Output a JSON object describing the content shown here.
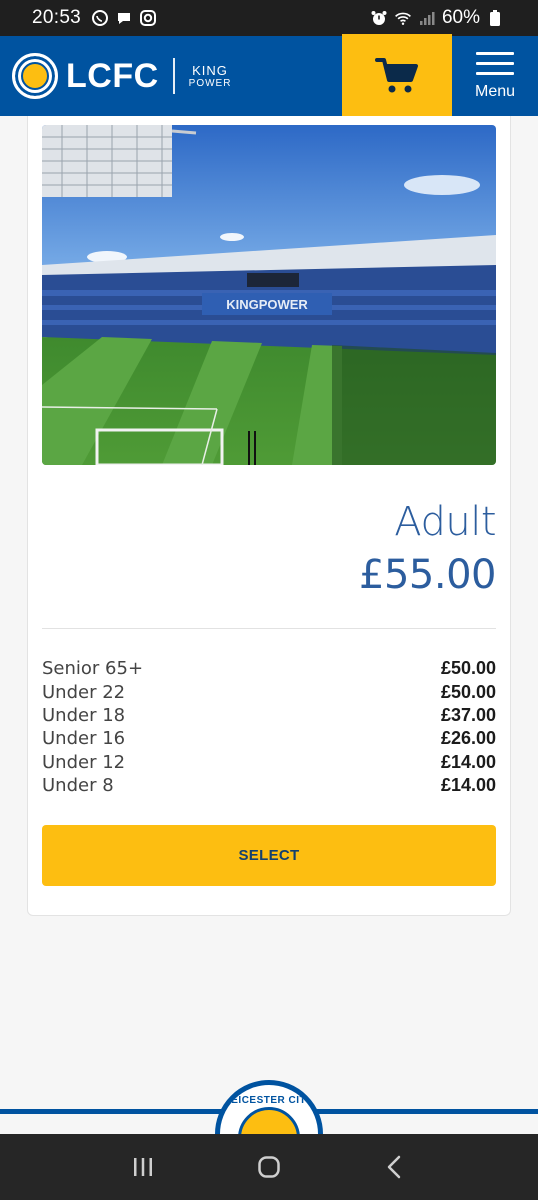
{
  "status_bar": {
    "time": "20:53",
    "battery": "60%"
  },
  "header": {
    "brand": "LCFC",
    "sponsor_line1": "KING",
    "sponsor_line2": "POWER",
    "menu_label": "Menu"
  },
  "product": {
    "title": "Adult",
    "price": "£55.00",
    "variants": [
      {
        "label": "Senior 65+",
        "price": "£50.00"
      },
      {
        "label": "Under 22",
        "price": "£50.00"
      },
      {
        "label": "Under 18",
        "price": "£37.00"
      },
      {
        "label": "Under 16",
        "price": "£26.00"
      },
      {
        "label": "Under 12",
        "price": "£14.00"
      },
      {
        "label": "Under 8",
        "price": "£14.00"
      }
    ],
    "select_label": "SELECT"
  },
  "footer": {
    "crest_text": "LEICESTER CITY"
  },
  "colors": {
    "brand_blue": "#0053a0",
    "accent_yellow": "#fdbe11",
    "price_blue": "#2c5d9e"
  }
}
